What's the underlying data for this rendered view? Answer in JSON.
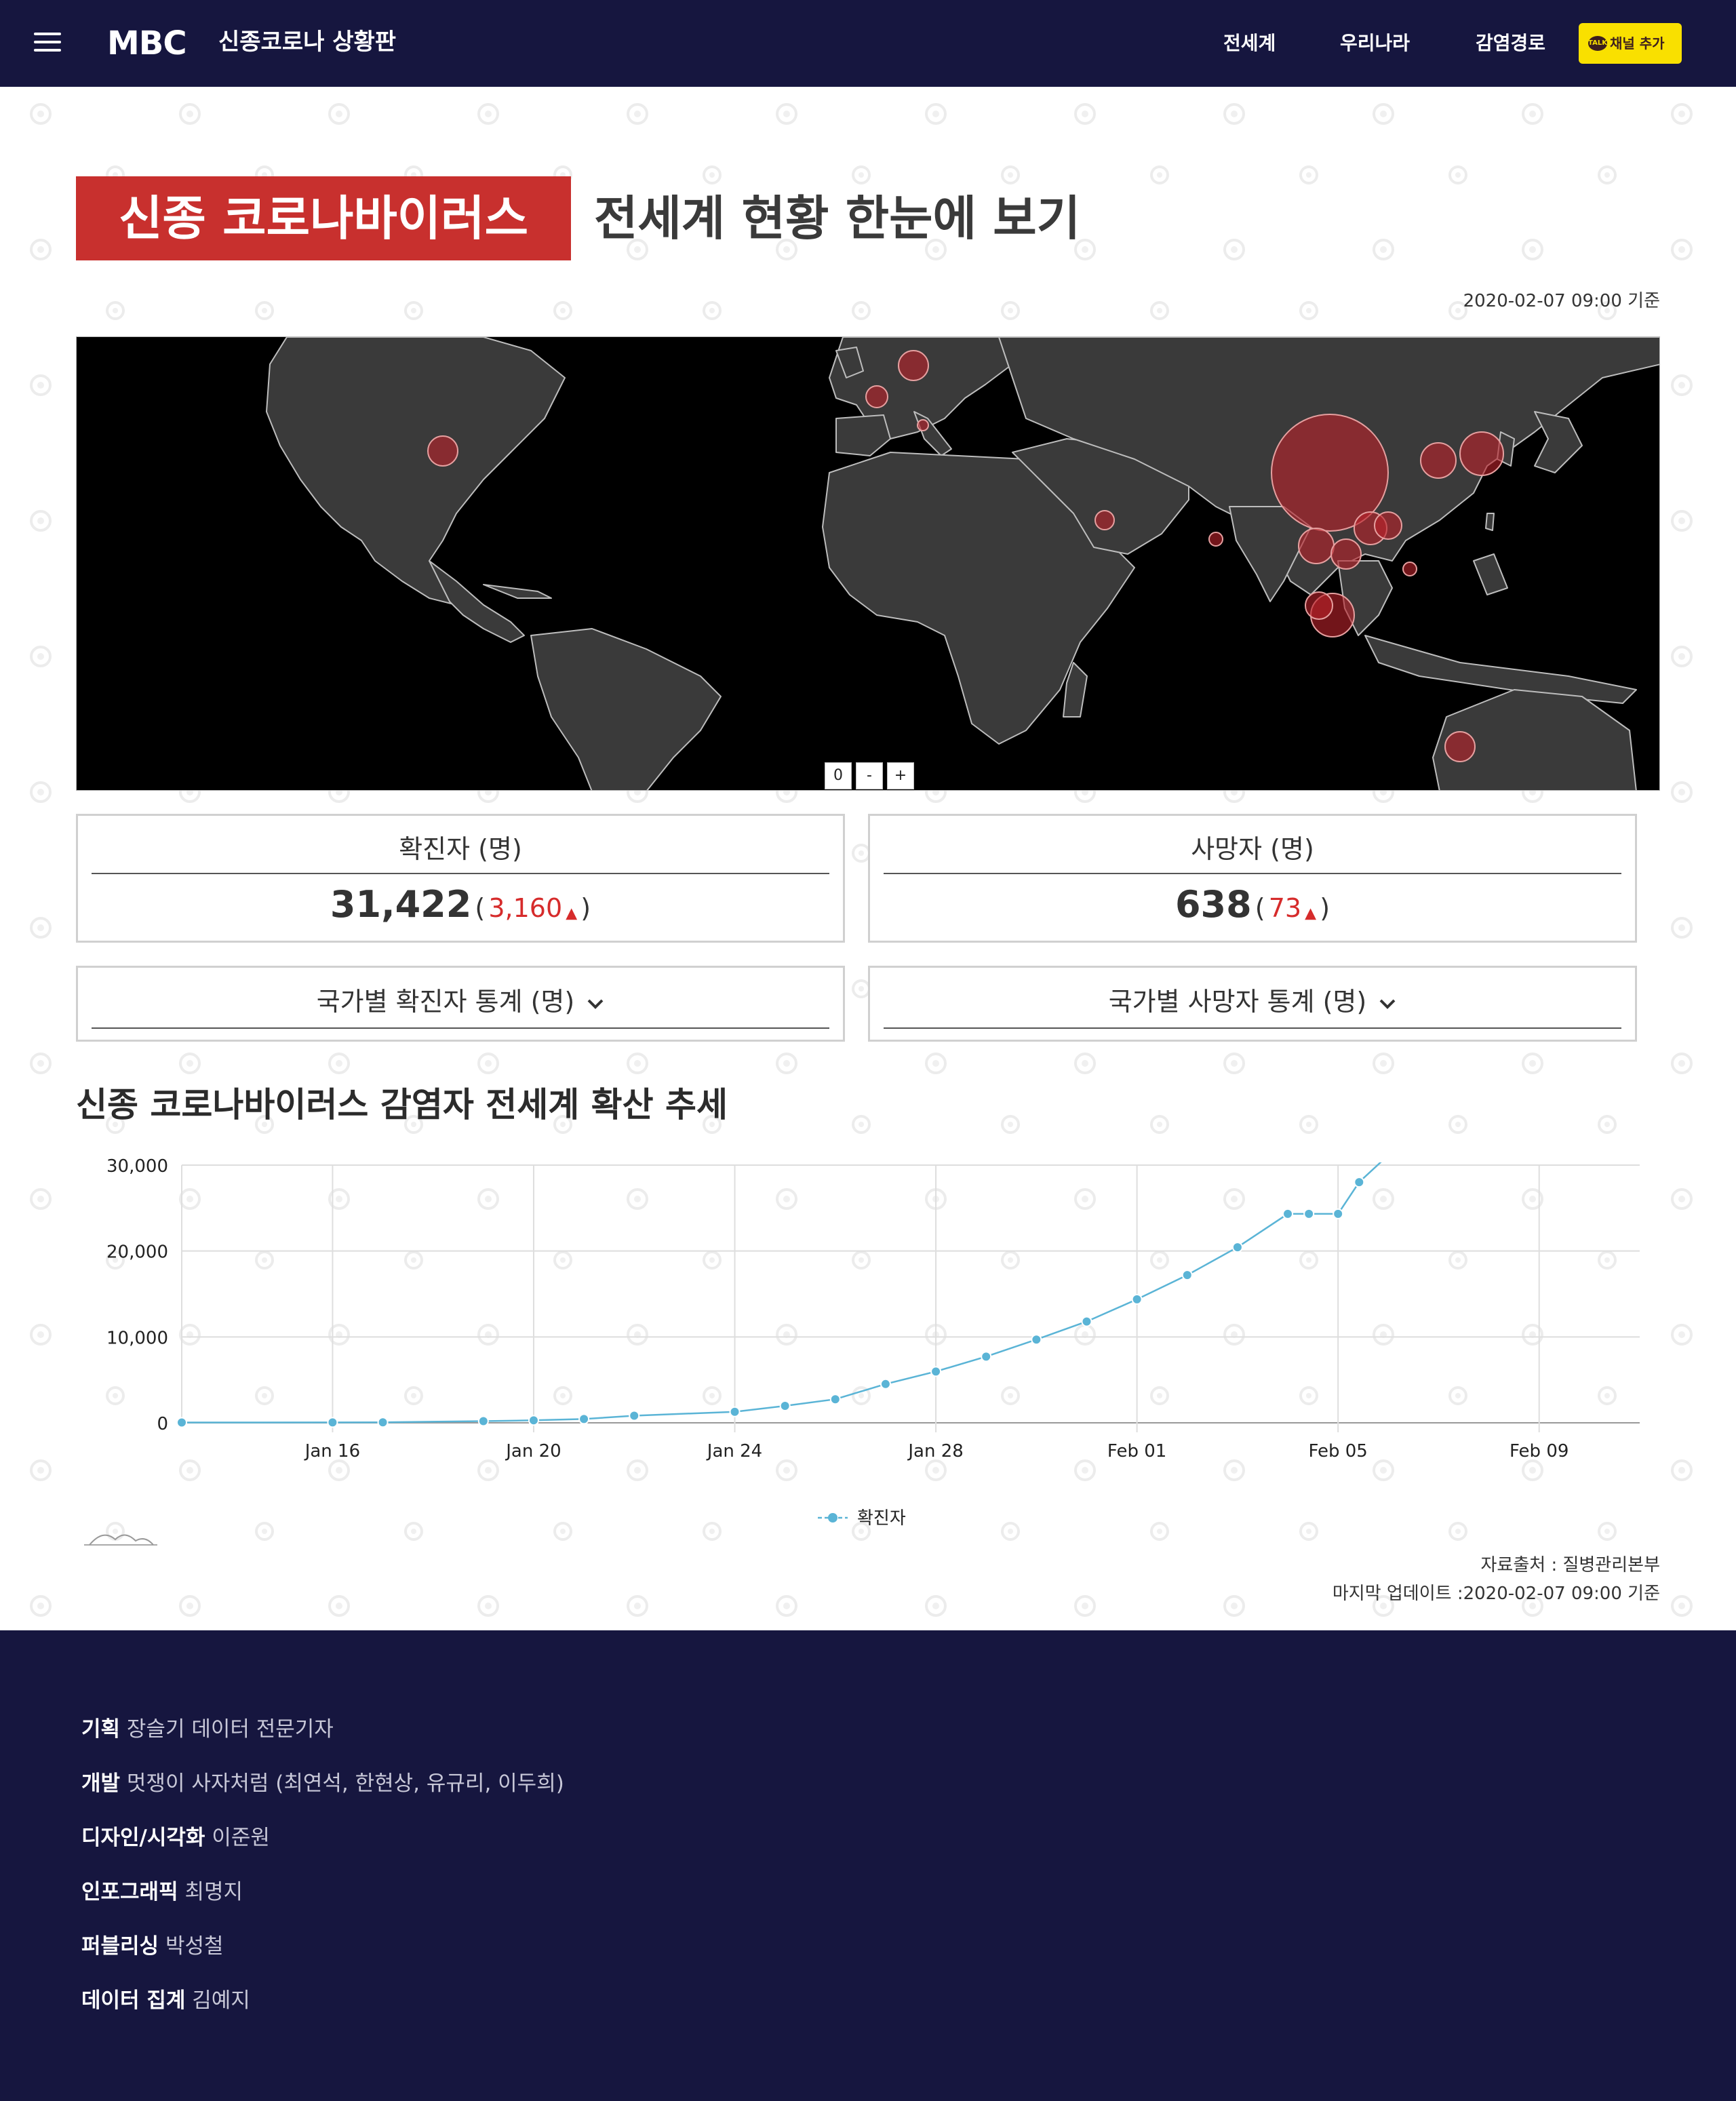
{
  "header": {
    "logo": "MBC",
    "site_title": "신종코로나 상황판",
    "nav": [
      "전세계",
      "우리나라",
      "감염경로"
    ],
    "channel_button": "채널 추가",
    "channel_icon": "TALK"
  },
  "title": {
    "badge": "신종 코로나바이러스",
    "headline": "전세계 현황 한눈에 보기",
    "as_of": "2020-02-07 09:00 기준"
  },
  "map": {
    "zoom_controls": [
      "0",
      "-",
      "+"
    ]
  },
  "stats": {
    "confirmed": {
      "label": "확진자 (명)",
      "value": "31,422",
      "open_paren": "(",
      "delta": "3,160",
      "close_paren": ")",
      "arrow": "▲"
    },
    "deaths": {
      "label": "사망자 (명)",
      "value": "638",
      "open_paren": "(",
      "delta": "73",
      "close_paren": ")",
      "arrow": "▲"
    }
  },
  "dropdowns": {
    "confirmed_by_country": "국가별 확진자 통계 (명)",
    "deaths_by_country": "국가별 사망자 통계 (명)"
  },
  "chart_section_title": "신종 코로나바이러스 감염자 전세계 확산 추세",
  "chart_data": {
    "type": "line",
    "title": "",
    "xlabel": "",
    "ylabel": "",
    "x_ticks": [
      "Jan 16",
      "Jan 20",
      "Jan 24",
      "Jan 28",
      "Feb 01",
      "Feb 05",
      "Feb 09"
    ],
    "y_ticks": [
      "0",
      "10,000",
      "20,000",
      "30,000"
    ],
    "ylim": [
      0,
      30000
    ],
    "xlim_days": [
      -3,
      26
    ],
    "grid": true,
    "legend_position": "bottom",
    "series": [
      {
        "name": "확진자",
        "color": "#5ab4d6",
        "points": [
          [
            "Jan 13",
            41
          ],
          [
            "Jan 16",
            45
          ],
          [
            "Jan 17",
            62
          ],
          [
            "Jan 19",
            201
          ],
          [
            "Jan 20",
            291
          ],
          [
            "Jan 21",
            440
          ],
          [
            "Jan 22",
            830
          ],
          [
            "Jan 24",
            1287
          ],
          [
            "Jan 25",
            1975
          ],
          [
            "Jan 26",
            2744
          ],
          [
            "Jan 27",
            4515
          ],
          [
            "Jan 28",
            5974
          ],
          [
            "Jan 29",
            7711
          ],
          [
            "Jan 30",
            9692
          ],
          [
            "Jan 31",
            11791
          ],
          [
            "Feb 01",
            14380
          ],
          [
            "Feb 02",
            17205
          ],
          [
            "Feb 03",
            20438
          ],
          [
            "Feb 04",
            24324
          ],
          [
            "Feb 04",
            24324
          ],
          [
            "Feb 05",
            24324
          ],
          [
            "Feb 05",
            28018
          ],
          [
            "Feb 06",
            31161
          ]
        ]
      }
    ]
  },
  "source": {
    "text": "자료출처 : 질병관리본부",
    "updated": "마지막 업데이트 :2020-02-07 09:00 기준"
  },
  "footer": {
    "credits": [
      {
        "role": "기획",
        "names": "장슬기 데이터 전문기자"
      },
      {
        "role": "개발",
        "names": "멋쟁이 사자처럼 (최연석, 한현상, 유규리, 이두희)"
      },
      {
        "role": "디자인/시각화",
        "names": "이준원"
      },
      {
        "role": "인포그래픽",
        "names": "최명지"
      },
      {
        "role": "퍼블리싱",
        "names": "박성철"
      },
      {
        "role": "데이터 집계",
        "names": "김예지"
      }
    ]
  },
  "colors": {
    "navy": "#16163f",
    "red": "#c8302e",
    "kakao_yellow": "#f9e000",
    "bubble": "#b8222a",
    "line": "#5ab4d6"
  }
}
